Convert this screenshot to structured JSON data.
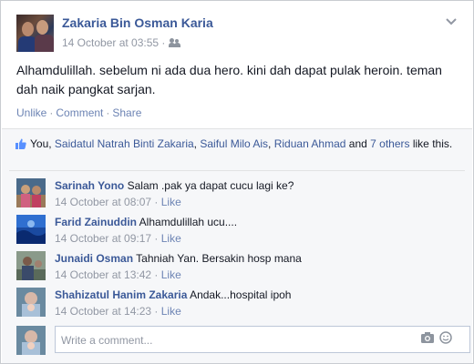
{
  "post": {
    "author": "Zakaria Bin Osman Karia",
    "timestamp": "14 October at 03:55 ·",
    "audience_icon": "friends-icon",
    "text": "Alhamdulillah. sebelum ni ada dua hero. kini dah dapat pulak heroin. teman dah naik pangkat sarjan.",
    "actions": {
      "unlike": "Unlike",
      "comment": "Comment",
      "share": "Share",
      "separator": "·"
    }
  },
  "likes": {
    "prefix": "You, ",
    "names": [
      "Saidatul Natrah Binti Zakaria",
      "Saiful Milo Ais",
      "Riduan Ahmad"
    ],
    "sep1": ", ",
    "sep2": ", ",
    "and": " and ",
    "others": "7 others",
    "suffix": " like this."
  },
  "comments": [
    {
      "name": "Sarinah Yono",
      "text": "Salam .pak ya dapat cucu lagi ke?",
      "time": "14 October at 08:07",
      "like": "Like"
    },
    {
      "name": "Farid Zainuddin",
      "text": "Alhamdulillah ucu....",
      "time": "14 October at 09:17",
      "like": "Like"
    },
    {
      "name": "Junaidi Osman",
      "text": "Tahniah Yan. Bersakin hosp mana",
      "time": "14 October at 13:42",
      "like": "Like"
    },
    {
      "name": "Shahizatul Hanim Zakaria",
      "text": "Andak...hospital ipoh",
      "time": "14 October at 14:23",
      "like": "Like"
    }
  ],
  "composer": {
    "placeholder": "Write a comment..."
  },
  "colors": {
    "link": "#3b5998",
    "meta": "#9197a3",
    "ufi_bg": "#f6f7f9"
  }
}
